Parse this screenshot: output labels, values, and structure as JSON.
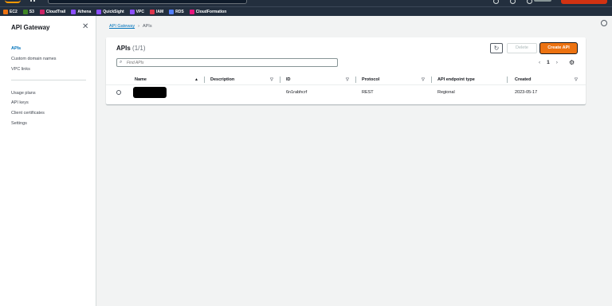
{
  "favorites": [
    {
      "label": "EC2",
      "color": "#ec7211"
    },
    {
      "label": "S3",
      "color": "#3f8624"
    },
    {
      "label": "CloudTrail",
      "color": "#cc2264"
    },
    {
      "label": "Athena",
      "color": "#8c4fff"
    },
    {
      "label": "QuickSight",
      "color": "#8c4fff"
    },
    {
      "label": "VPC",
      "color": "#8c4fff"
    },
    {
      "label": "IAM",
      "color": "#dd344c"
    },
    {
      "label": "RDS",
      "color": "#527fff"
    },
    {
      "label": "CloudFormation",
      "color": "#e7157b"
    }
  ],
  "sidebar": {
    "title": "API Gateway",
    "items": [
      "APIs",
      "Custom domain names",
      "VPC links"
    ],
    "items2": [
      "Usage plans",
      "API keys",
      "Client certificates",
      "Settings"
    ]
  },
  "breadcrumb": {
    "root": "API Gateway",
    "current": "APIs"
  },
  "panel": {
    "title": "APIs",
    "count": "(1/1)",
    "delete_label": "Delete",
    "create_label": "Create API",
    "search_placeholder": "Find APIs",
    "page": "1"
  },
  "table": {
    "columns": [
      "Name",
      "Description",
      "ID",
      "Protocol",
      "API endpoint type",
      "Created"
    ],
    "rows": [
      {
        "name": "",
        "description": "",
        "id": "6n1rabhcrf",
        "protocol": "REST",
        "endpoint_type": "Regional",
        "created": "2023-05-17"
      }
    ]
  }
}
